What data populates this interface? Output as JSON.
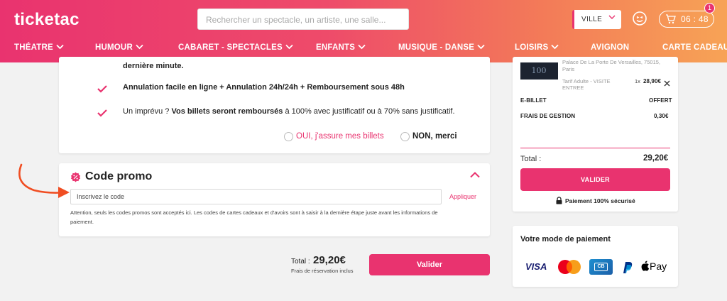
{
  "header": {
    "logo": "ticketac",
    "search_placeholder": "Rechercher un spectacle, un artiste, une salle...",
    "ville_label": "VILLE",
    "cart_timer": "06 : 48",
    "cart_count": "1",
    "brand_color": "#e9336f"
  },
  "nav": [
    {
      "label": "THÉATRE"
    },
    {
      "label": "HUMOUR"
    },
    {
      "label": "CABARET - SPECTACLES"
    },
    {
      "label": "ENFANTS"
    },
    {
      "label": "MUSIQUE - DANSE"
    },
    {
      "label": "LOISIRS"
    },
    {
      "label": "AVIGNON"
    },
    {
      "label": "CARTE CADEAU"
    }
  ],
  "insurance": {
    "line1": "dernière minute.",
    "line2": "Annulation facile en ligne + Annulation 24h/24h + Remboursement sous 48h",
    "line3_a": "Un imprévu ? ",
    "line3_b": "Vos billets seront remboursés",
    "line3_c": " à 100% avec justificatif ou à 70% sans justificatif.",
    "yes": "OUI, j'assure mes billets",
    "no": "NON, merci"
  },
  "promo": {
    "title": "Code promo",
    "placeholder": "Inscrivez le code",
    "apply": "Appliquer",
    "notice_line1": "Attention, seuls les codes promos sont acceptés ici. Les codes de cartes cadeaux et d'avoirs sont à saisir à la dernière étape juste avant les informations de",
    "notice_line2": "paiement."
  },
  "footer_total": {
    "label": "Total :",
    "value": "29,20€",
    "sub": "Frais de réservation inclus",
    "button": "Valider"
  },
  "summary": {
    "venue_line1": "Palace De La Porte De Versailles, 75015,",
    "venue_line2": "Paris",
    "ticket_line1": "Tarif Adulte - VISITE",
    "ticket_line2": "ENTREE",
    "qty": "1x",
    "price": "28,90€",
    "ebillet_label": "E-BILLET",
    "ebillet_value": "OFFERT",
    "frais_label": "FRAIS DE GESTION",
    "frais_value": "0,30€",
    "total_label": "Total :",
    "total_value": "29,20€",
    "button": "VALIDER",
    "secure": "Paiement 100% sécurisé"
  },
  "payment": {
    "title": "Votre mode de paiement",
    "visa": "VISA",
    "cb": "CB",
    "applepay": "Pay"
  }
}
